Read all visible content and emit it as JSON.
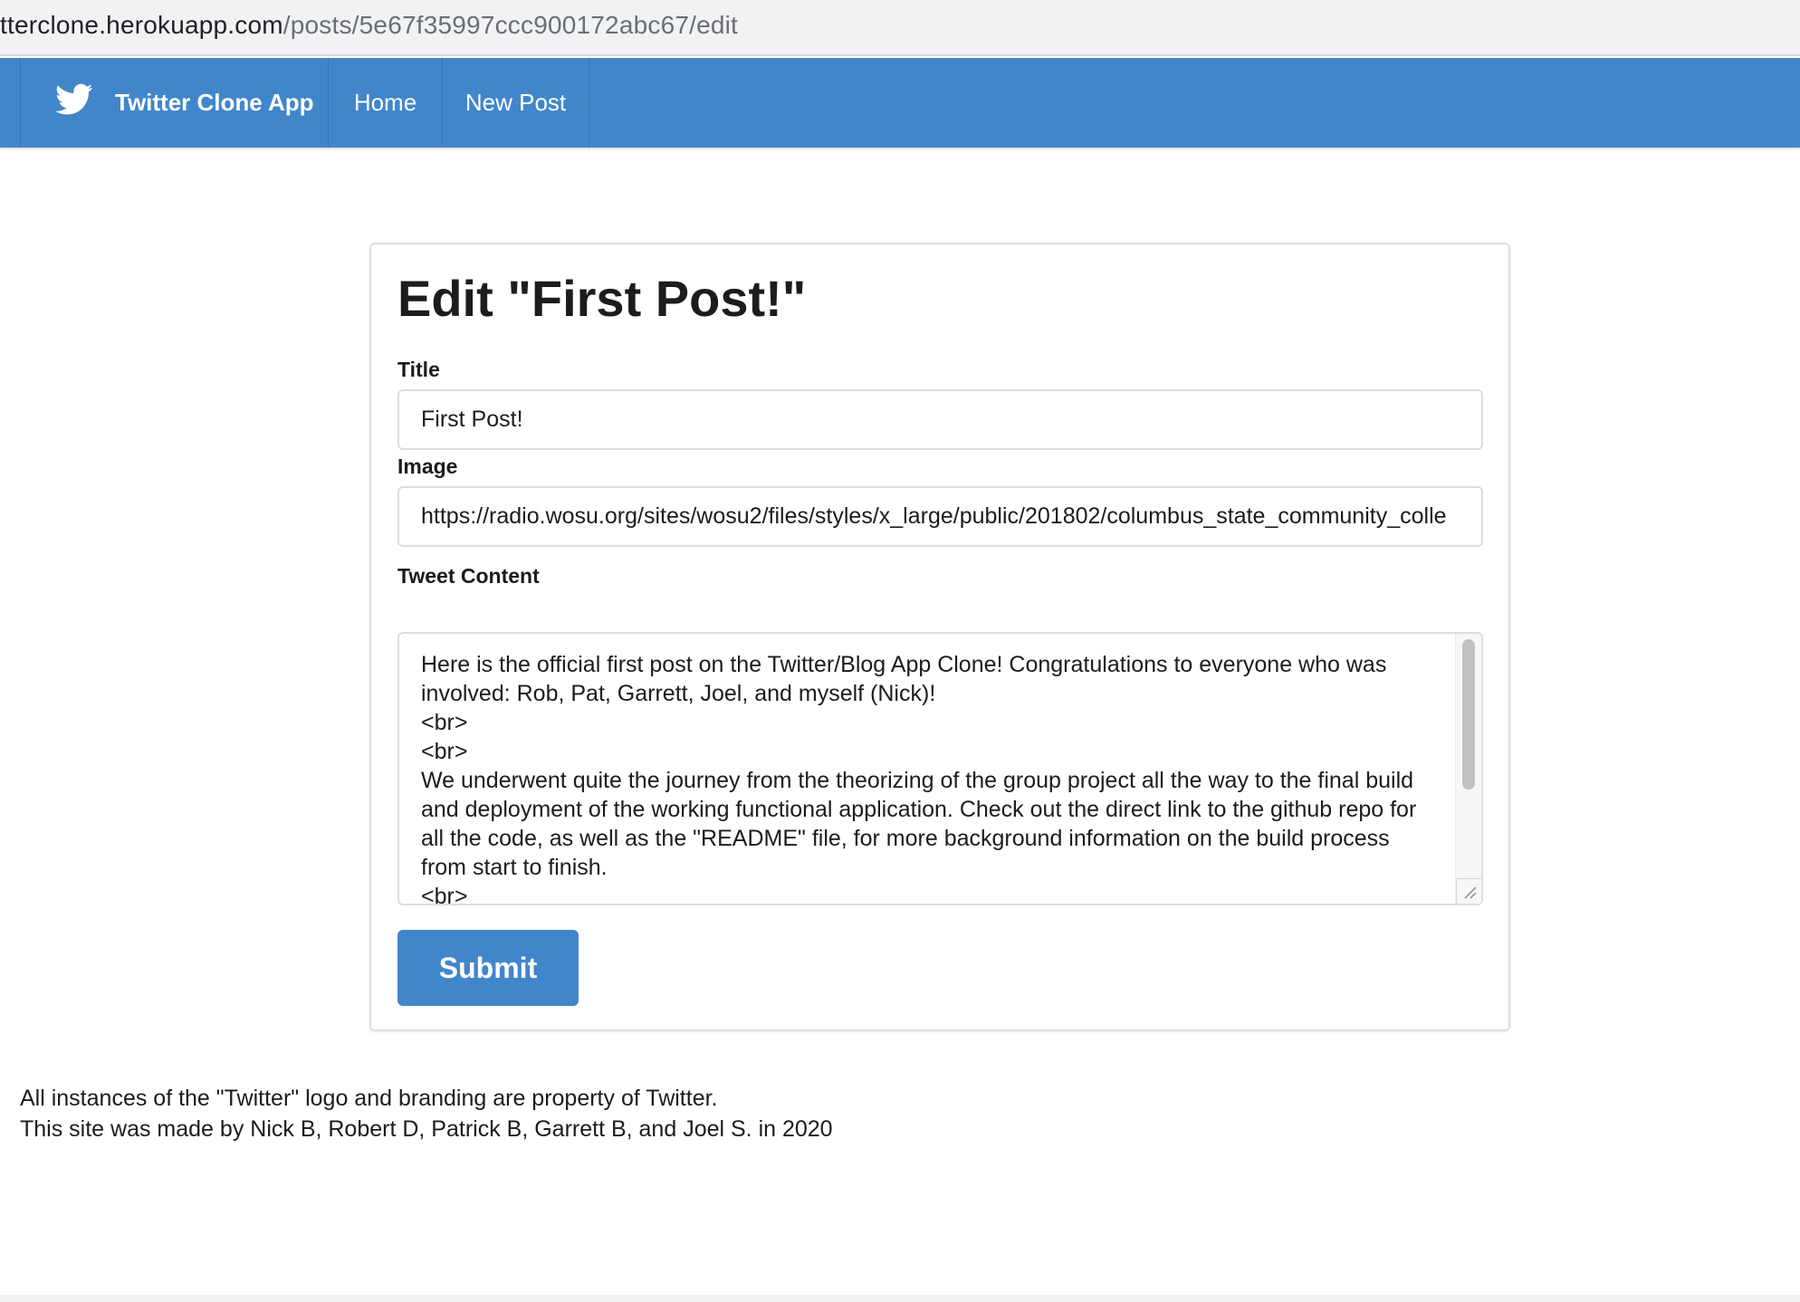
{
  "browser": {
    "url_host": "tterclone.herokuapp.com",
    "url_path": "/posts/5e67f35997ccc900172abc67/edit"
  },
  "navbar": {
    "brand": "Twitter Clone App",
    "brand_icon": "twitter-bird-icon",
    "items": [
      {
        "label": "Home"
      },
      {
        "label": "New Post"
      }
    ],
    "color": "#4186cb"
  },
  "form": {
    "heading": "Edit \"First Post!\"",
    "title_label": "Title",
    "title_value": "First Post!",
    "image_label": "Image",
    "image_value": "https://radio.wosu.org/sites/wosu2/files/styles/x_large/public/201802/columbus_state_community_colle",
    "content_label": "Tweet Content",
    "content_value": "Here is the official first post on the Twitter/Blog App Clone! Congratulations to everyone who was involved: Rob, Pat, Garrett, Joel, and myself (Nick)!\n<br>\n<br>\nWe underwent quite the journey from the theorizing of the group project all the way to the final build and deployment of the working functional application. Check out the direct link to the github repo for all the code, as well as the \"README\" file, for more background information on the build process from start to finish.\n<br>",
    "submit_label": "Submit"
  },
  "footer": {
    "line1": "All instances of the \"Twitter\" logo and branding are property of Twitter.",
    "line2": "This site was made by Nick B, Robert D, Patrick B, Garrett B, and Joel S. in 2020"
  }
}
